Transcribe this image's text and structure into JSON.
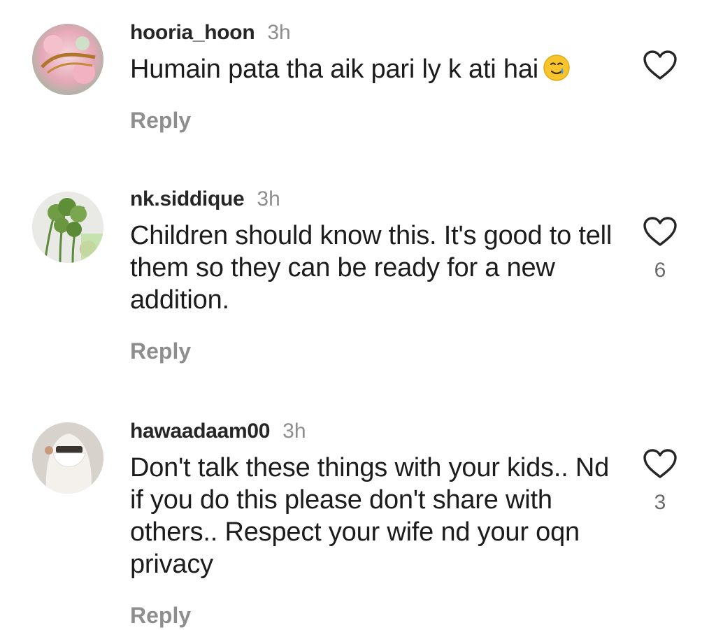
{
  "comments": [
    {
      "username": "hooria_hoon",
      "time": "3h",
      "text": "Humain pata tha aik pari ly k ati hai",
      "emoji": "smiling-face-with-tear",
      "reply_label": "Reply",
      "likes": ""
    },
    {
      "username": "nk.siddique",
      "time": "3h",
      "text": "Children should know this. It's good to tell them so they can be ready for a new addition.",
      "reply_label": "Reply",
      "likes": "6"
    },
    {
      "username": "hawaadaam00",
      "time": "3h",
      "text": "Don't talk these things with your kids.. Nd if you do this please don't share with others.. Respect your wife nd your oqn privacy",
      "reply_label": "Reply",
      "likes": "3"
    }
  ],
  "colors": {
    "text": "#1c1c1c",
    "username": "#262626",
    "muted": "#8e8e8e",
    "like_outline": "#262626"
  },
  "icons": {
    "like": "heart-outline-icon"
  }
}
